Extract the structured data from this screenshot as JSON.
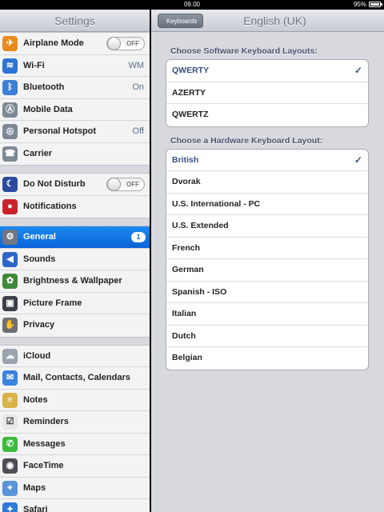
{
  "status": {
    "time": "09.00",
    "battery": "95%"
  },
  "left": {
    "title": "Settings",
    "groups": [
      [
        {
          "label": "Airplane Mode",
          "toggle": "OFF",
          "icon": "airplane-icon",
          "color": "#e98a1f",
          "glyph": "✈"
        },
        {
          "label": "Wi-Fi",
          "value": "WM",
          "icon": "wifi-icon",
          "color": "#2d73d6",
          "glyph": "≋"
        },
        {
          "label": "Bluetooth",
          "value": "On",
          "icon": "bluetooth-icon",
          "color": "#3d7fd6",
          "glyph": "ᛒ"
        },
        {
          "label": "Mobile Data",
          "icon": "antenna-icon",
          "color": "#7e8896",
          "glyph": "Ⓐ"
        },
        {
          "label": "Personal Hotspot",
          "value": "Off",
          "icon": "hotspot-icon",
          "color": "#7e8896",
          "glyph": "◎"
        },
        {
          "label": "Carrier",
          "icon": "phone-icon",
          "color": "#7e8896",
          "glyph": "☎"
        }
      ],
      [
        {
          "label": "Do Not Disturb",
          "toggle": "OFF",
          "icon": "moon-icon",
          "color": "#2b4c9e",
          "glyph": "☾"
        },
        {
          "label": "Notifications",
          "icon": "notifications-icon",
          "color": "#c8232c",
          "glyph": "●"
        }
      ],
      [
        {
          "label": "General",
          "badge": "1",
          "selected": true,
          "icon": "gear-icon",
          "color": "#6f7784",
          "glyph": "⚙"
        },
        {
          "label": "Sounds",
          "icon": "speaker-icon",
          "color": "#2e66c8",
          "glyph": "◀"
        },
        {
          "label": "Brightness & Wallpaper",
          "icon": "flower-icon",
          "color": "#3f8a3a",
          "glyph": "✿"
        },
        {
          "label": "Picture Frame",
          "icon": "picture-frame-icon",
          "color": "#3c4048",
          "glyph": "▣"
        },
        {
          "label": "Privacy",
          "icon": "hand-icon",
          "color": "#6e6f74",
          "glyph": "✋"
        }
      ],
      [
        {
          "label": "iCloud",
          "icon": "cloud-icon",
          "color": "#9aa3ae",
          "glyph": "☁"
        },
        {
          "label": "Mail, Contacts, Calendars",
          "icon": "mail-icon",
          "color": "#3a84e0",
          "glyph": "✉"
        },
        {
          "label": "Notes",
          "icon": "notes-icon",
          "color": "#d9b34a",
          "glyph": "≡"
        },
        {
          "label": "Reminders",
          "icon": "reminders-icon",
          "color": "#e8e8e8",
          "glyph": "☑"
        },
        {
          "label": "Messages",
          "icon": "messages-icon",
          "color": "#3dbb3f",
          "glyph": "✆"
        },
        {
          "label": "FaceTime",
          "icon": "facetime-icon",
          "color": "#4c4f55",
          "glyph": "◉"
        },
        {
          "label": "Maps",
          "icon": "maps-icon",
          "color": "#5a95d8",
          "glyph": "⌖"
        },
        {
          "label": "Safari",
          "icon": "safari-icon",
          "color": "#2d7ad8",
          "glyph": "✦"
        }
      ]
    ]
  },
  "right": {
    "back": "Keyboards",
    "title": "English (UK)",
    "software_header": "Choose Software Keyboard Layouts:",
    "software": [
      {
        "label": "QWERTY",
        "checked": true
      },
      {
        "label": "AZERTY"
      },
      {
        "label": "QWERTZ"
      }
    ],
    "hardware_header": "Choose a Hardware Keyboard Layout:",
    "hardware": [
      {
        "label": "British",
        "checked": true
      },
      {
        "label": "Dvorak"
      },
      {
        "label": "U.S. International - PC"
      },
      {
        "label": "U.S. Extended"
      },
      {
        "label": "French"
      },
      {
        "label": "German"
      },
      {
        "label": "Spanish - ISO"
      },
      {
        "label": "Italian"
      },
      {
        "label": "Dutch"
      },
      {
        "label": "Belgian"
      }
    ],
    "checkmark": "✓"
  }
}
